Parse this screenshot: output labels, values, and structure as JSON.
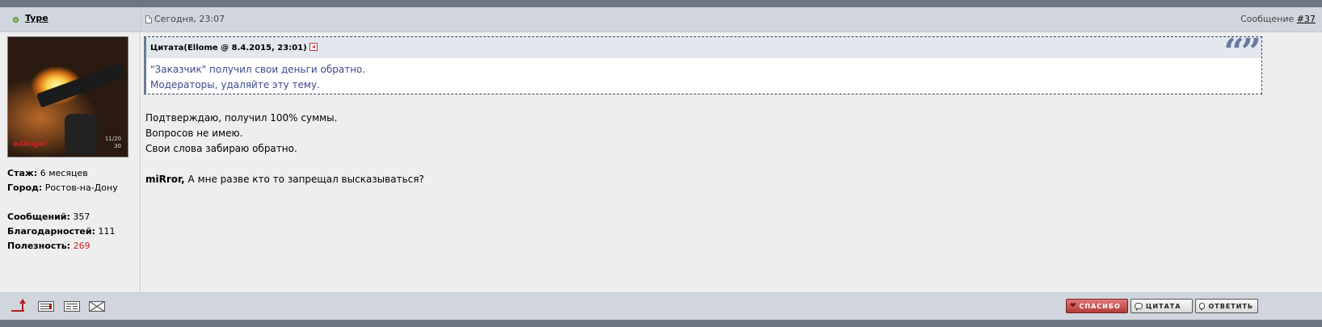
{
  "post": {
    "author": "Type",
    "date": "Сегодня, 23:07",
    "post_number_label": "Сообщение",
    "post_number": "#37"
  },
  "avatar": {
    "tag": "edAngel",
    "hud_line1": "11/20",
    "hud_line2": "30"
  },
  "profile": {
    "experience_label": "Стаж:",
    "experience_value": "6 месяцев",
    "city_label": "Город:",
    "city_value": "Ростов-на-Дону",
    "messages_label": "Сообщений:",
    "messages_value": "357",
    "thanks_label": "Благодарностей:",
    "thanks_value": "111",
    "usefulness_label": "Полезность:",
    "usefulness_value": "269"
  },
  "quote": {
    "title": "Цитата(Ellome @ 8.4.2015, 23:01)",
    "marks": "“”",
    "lines": [
      "\"Заказчик\" получил свои деньги обратно.",
      "Модераторы, удаляйте эту тему."
    ]
  },
  "message": {
    "lines": [
      "Подтверждаю, получил 100% суммы.",
      "Вопросов не имею.",
      "Свои слова забираю обратно."
    ],
    "mention": "miRror,",
    "mention_text": " А мне разве кто то запрещал высказываться?"
  },
  "footer": {
    "thanks_label": "СПАСИБО",
    "quote_label": "ЦИТАТА",
    "reply_label": "ОТВЕТИТЬ"
  },
  "colors": {
    "header_bg": "#d1d6de",
    "body_bg": "#eeeeee",
    "quote_text": "#3b4a8c",
    "usefulness": "#cc2222",
    "thanks_button": "#b33a3a"
  },
  "icons": {
    "online": "online-status-dot-icon",
    "post_doc": "document-icon",
    "quote_back": "arrow-left-icon",
    "to_top": "arrow-up-icon",
    "profile": "profile-card-icon",
    "card": "business-card-icon",
    "mail": "envelope-icon",
    "thanks": "heart-icon",
    "quote": "speech-bubble-icon",
    "reply": "speech-bubble-icon"
  }
}
